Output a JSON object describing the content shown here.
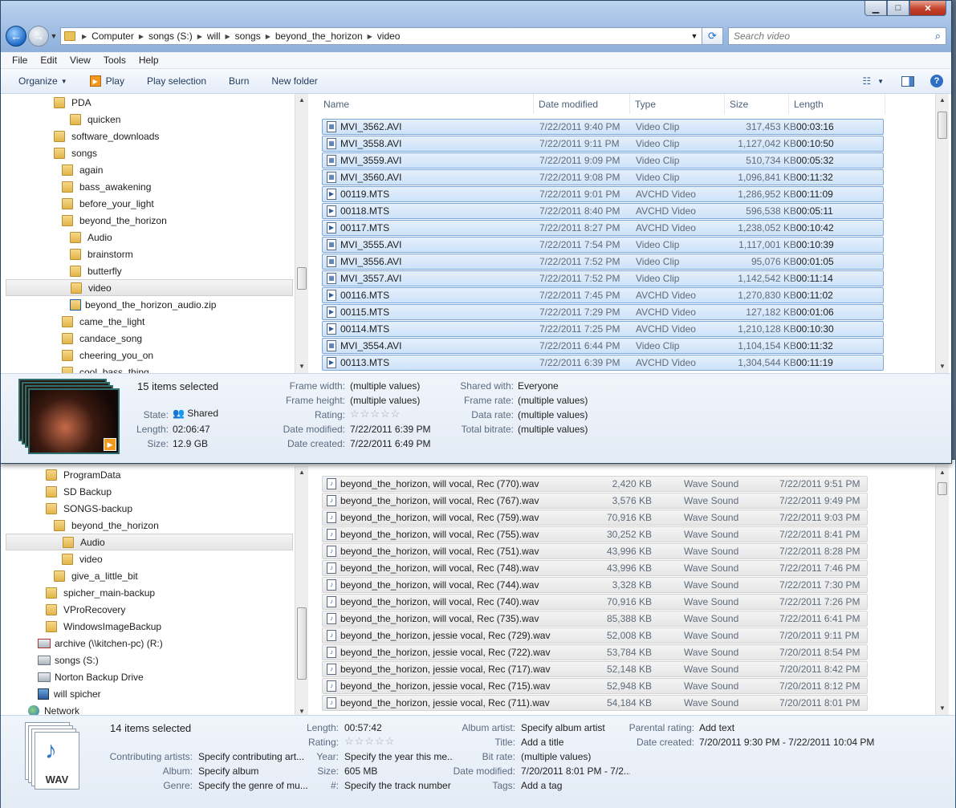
{
  "window1": {
    "address": [
      "Computer",
      "songs (S:)",
      "will",
      "songs",
      "beyond_the_horizon",
      "video"
    ],
    "search_placeholder": "Search video",
    "menu": [
      "File",
      "Edit",
      "View",
      "Tools",
      "Help"
    ],
    "toolbar": {
      "organize": "Organize",
      "play": "Play",
      "play_selection": "Play selection",
      "burn": "Burn",
      "new_folder": "New folder"
    },
    "tree": [
      {
        "label": "PDA"
      },
      {
        "label": "quicken"
      },
      {
        "label": "software_downloads"
      },
      {
        "label": "songs"
      },
      {
        "label": "again"
      },
      {
        "label": "bass_awakening"
      },
      {
        "label": "before_your_light"
      },
      {
        "label": "beyond_the_horizon"
      },
      {
        "label": "Audio"
      },
      {
        "label": "brainstorm"
      },
      {
        "label": "butterfly"
      },
      {
        "label": "video"
      },
      {
        "label": "beyond_the_horizon_audio.zip"
      },
      {
        "label": "came_the_light"
      },
      {
        "label": "candace_song"
      },
      {
        "label": "cheering_you_on"
      },
      {
        "label": "cool_bass_thing"
      }
    ],
    "columns": [
      "Name",
      "Date modified",
      "Type",
      "Size",
      "Length"
    ],
    "files": [
      {
        "name": "MVI_3562.AVI",
        "date": "7/22/2011 9:40 PM",
        "type": "Video Clip",
        "size": "317,453 KB",
        "length": "00:03:16"
      },
      {
        "name": "MVI_3558.AVI",
        "date": "7/22/2011 9:11 PM",
        "type": "Video Clip",
        "size": "1,127,042 KB",
        "length": "00:10:50"
      },
      {
        "name": "MVI_3559.AVI",
        "date": "7/22/2011 9:09 PM",
        "type": "Video Clip",
        "size": "510,734 KB",
        "length": "00:05:32"
      },
      {
        "name": "MVI_3560.AVI",
        "date": "7/22/2011 9:08 PM",
        "type": "Video Clip",
        "size": "1,096,841 KB",
        "length": "00:11:32"
      },
      {
        "name": "00119.MTS",
        "date": "7/22/2011 9:01 PM",
        "type": "AVCHD Video",
        "size": "1,286,952 KB",
        "length": "00:11:09"
      },
      {
        "name": "00118.MTS",
        "date": "7/22/2011 8:40 PM",
        "type": "AVCHD Video",
        "size": "596,538 KB",
        "length": "00:05:11"
      },
      {
        "name": "00117.MTS",
        "date": "7/22/2011 8:27 PM",
        "type": "AVCHD Video",
        "size": "1,238,052 KB",
        "length": "00:10:42"
      },
      {
        "name": "MVI_3555.AVI",
        "date": "7/22/2011 7:54 PM",
        "type": "Video Clip",
        "size": "1,117,001 KB",
        "length": "00:10:39"
      },
      {
        "name": "MVI_3556.AVI",
        "date": "7/22/2011 7:52 PM",
        "type": "Video Clip",
        "size": "95,076 KB",
        "length": "00:01:05"
      },
      {
        "name": "MVI_3557.AVI",
        "date": "7/22/2011 7:52 PM",
        "type": "Video Clip",
        "size": "1,142,542 KB",
        "length": "00:11:14"
      },
      {
        "name": "00116.MTS",
        "date": "7/22/2011 7:45 PM",
        "type": "AVCHD Video",
        "size": "1,270,830 KB",
        "length": "00:11:02"
      },
      {
        "name": "00115.MTS",
        "date": "7/22/2011 7:29 PM",
        "type": "AVCHD Video",
        "size": "127,182 KB",
        "length": "00:01:06"
      },
      {
        "name": "00114.MTS",
        "date": "7/22/2011 7:25 PM",
        "type": "AVCHD Video",
        "size": "1,210,128 KB",
        "length": "00:10:30"
      },
      {
        "name": "MVI_3554.AVI",
        "date": "7/22/2011 6:44 PM",
        "type": "Video Clip",
        "size": "1,104,154 KB",
        "length": "00:11:32"
      },
      {
        "name": "00113.MTS",
        "date": "7/22/2011 6:39 PM",
        "type": "AVCHD Video",
        "size": "1,304,544 KB",
        "length": "00:11:19"
      }
    ],
    "details": {
      "selected": "15 items selected",
      "state_label": "State:",
      "state": "Shared",
      "length_label": "Length:",
      "length": "02:06:47",
      "size_label": "Size:",
      "size": "12.9 GB",
      "frame_width_label": "Frame width:",
      "frame_width": "(multiple values)",
      "frame_height_label": "Frame height:",
      "frame_height": "(multiple values)",
      "rating_label": "Rating:",
      "date_modified_label": "Date modified:",
      "date_modified": "7/22/2011 6:39 PM",
      "date_created_label": "Date created:",
      "date_created": "7/22/2011 6:49 PM",
      "shared_with_label": "Shared with:",
      "shared_with": "Everyone",
      "frame_rate_label": "Frame rate:",
      "frame_rate": "(multiple values)",
      "data_rate_label": "Data rate:",
      "data_rate": "(multiple values)",
      "total_bitrate_label": "Total bitrate:",
      "total_bitrate": "(multiple values)"
    }
  },
  "window2": {
    "tree": [
      {
        "label": "ProgramData"
      },
      {
        "label": "SD Backup"
      },
      {
        "label": "SONGS-backup"
      },
      {
        "label": "beyond_the_horizon"
      },
      {
        "label": "Audio"
      },
      {
        "label": "video"
      },
      {
        "label": "give_a_little_bit"
      },
      {
        "label": "spicher_main-backup"
      },
      {
        "label": "VProRecovery"
      },
      {
        "label": "WindowsImageBackup"
      },
      {
        "label": "archive (\\\\kitchen-pc) (R:)"
      },
      {
        "label": "songs (S:)"
      },
      {
        "label": "Norton Backup Drive"
      },
      {
        "label": "will spicher"
      },
      {
        "label": "Network"
      }
    ],
    "files": [
      {
        "name": "beyond_the_horizon, will vocal, Rec (770).wav",
        "size": "2,420 KB",
        "type": "Wave Sound",
        "date": "7/22/2011 9:51 PM"
      },
      {
        "name": "beyond_the_horizon, will vocal, Rec (767).wav",
        "size": "3,576 KB",
        "type": "Wave Sound",
        "date": "7/22/2011 9:49 PM"
      },
      {
        "name": "beyond_the_horizon, will vocal, Rec (759).wav",
        "size": "70,916 KB",
        "type": "Wave Sound",
        "date": "7/22/2011 9:03 PM"
      },
      {
        "name": "beyond_the_horizon, will vocal, Rec (755).wav",
        "size": "30,252 KB",
        "type": "Wave Sound",
        "date": "7/22/2011 8:41 PM"
      },
      {
        "name": "beyond_the_horizon, will vocal, Rec (751).wav",
        "size": "43,996 KB",
        "type": "Wave Sound",
        "date": "7/22/2011 8:28 PM"
      },
      {
        "name": "beyond_the_horizon, will vocal, Rec (748).wav",
        "size": "43,996 KB",
        "type": "Wave Sound",
        "date": "7/22/2011 7:46 PM"
      },
      {
        "name": "beyond_the_horizon, will vocal, Rec (744).wav",
        "size": "3,328 KB",
        "type": "Wave Sound",
        "date": "7/22/2011 7:30 PM"
      },
      {
        "name": "beyond_the_horizon, will vocal, Rec (740).wav",
        "size": "70,916 KB",
        "type": "Wave Sound",
        "date": "7/22/2011 7:26 PM"
      },
      {
        "name": "beyond_the_horizon, will vocal, Rec (735).wav",
        "size": "85,388 KB",
        "type": "Wave Sound",
        "date": "7/22/2011 6:41 PM"
      },
      {
        "name": "beyond_the_horizon, jessie vocal, Rec (729).wav",
        "size": "52,008 KB",
        "type": "Wave Sound",
        "date": "7/20/2011 9:11 PM"
      },
      {
        "name": "beyond_the_horizon, jessie vocal, Rec (722).wav",
        "size": "53,784 KB",
        "type": "Wave Sound",
        "date": "7/20/2011 8:54 PM"
      },
      {
        "name": "beyond_the_horizon, jessie vocal, Rec (717).wav",
        "size": "52,148 KB",
        "type": "Wave Sound",
        "date": "7/20/2011 8:42 PM"
      },
      {
        "name": "beyond_the_horizon, jessie vocal, Rec (715).wav",
        "size": "52,948 KB",
        "type": "Wave Sound",
        "date": "7/20/2011 8:12 PM"
      },
      {
        "name": "beyond_the_horizon, jessie vocal, Rec (711).wav",
        "size": "54,184 KB",
        "type": "Wave Sound",
        "date": "7/20/2011 8:01 PM"
      }
    ],
    "details": {
      "selected": "14 items selected",
      "wav_label": "WAV",
      "contributing_label": "Contributing artists:",
      "contributing": "Specify contributing art...",
      "album_label": "Album:",
      "album": "Specify album",
      "genre_label": "Genre:",
      "genre": "Specify the genre of mu...",
      "length_label": "Length:",
      "length": "00:57:42",
      "rating_label": "Rating:",
      "year_label": "Year:",
      "year": "Specify the year this me...",
      "size_label": "Size:",
      "size": "605 MB",
      "track_label": "#:",
      "track": "Specify the track number",
      "album_artist_label": "Album artist:",
      "album_artist": "Specify album artist",
      "title_label": "Title:",
      "title": "Add a title",
      "bit_rate_label": "Bit rate:",
      "bit_rate": "(multiple values)",
      "date_modified_label": "Date modified:",
      "date_modified": "7/20/2011 8:01 PM - 7/2...",
      "tags_label": "Tags:",
      "tags": "Add a tag",
      "parental_label": "Parental rating:",
      "parental": "Add text",
      "date_created_label": "Date created:",
      "date_created": "7/20/2011 9:30 PM - 7/22/2011 10:04 PM"
    }
  }
}
